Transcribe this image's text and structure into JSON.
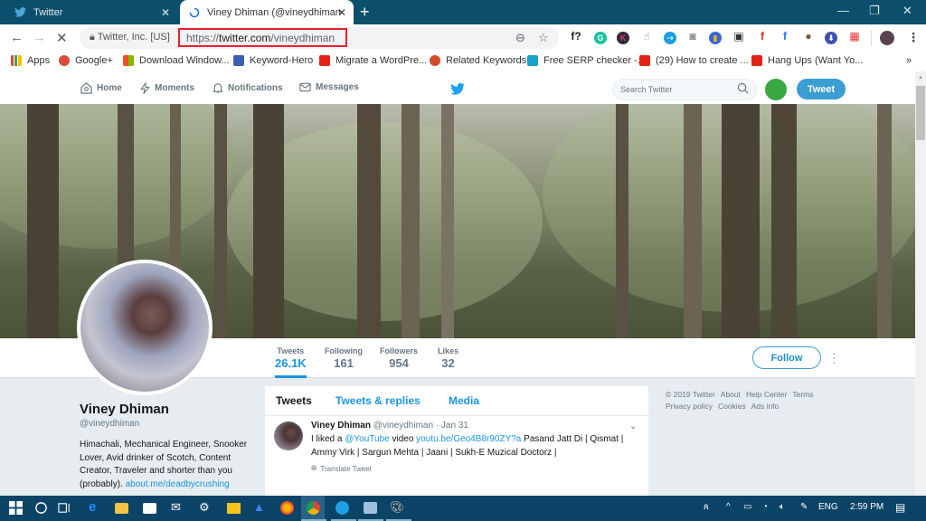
{
  "browser": {
    "tabs": [
      {
        "title": "Twitter",
        "active": false
      },
      {
        "title": "Viney Dhiman (@vineydhiman) | Twitter",
        "active": true
      }
    ],
    "new_tab_label": "+",
    "window_controls": {
      "minimize": "—",
      "maximize": "❐",
      "close": "✕"
    },
    "site_identity": "Twitter, Inc. [US]",
    "url_prefix": "https://",
    "url_domain": "twitter.com",
    "url_path": "/vineydhiman",
    "bookmarks": [
      {
        "label": "Apps",
        "icon": "apps-grid-icon",
        "color": "#e94235"
      },
      {
        "label": "Google+",
        "icon": "google-plus-icon",
        "color": "#dd4b39"
      },
      {
        "label": "Download Window...",
        "icon": "windows-icon",
        "color": "#00a4ef"
      },
      {
        "label": "Keyword-Hero",
        "icon": "keyword-hero-icon",
        "color": "#3b5fb0"
      },
      {
        "label": "Migrate a WordPre...",
        "icon": "youtube-icon",
        "color": "#e62117"
      },
      {
        "label": "Related Keywords",
        "icon": "circle-icon",
        "color": "#d44a2b"
      },
      {
        "label": "Free SERP checker -...",
        "icon": "serp-icon",
        "color": "#17a2c7"
      },
      {
        "label": "(29) How to create ...",
        "icon": "youtube-icon",
        "color": "#e62117"
      },
      {
        "label": "Hang Ups (Want Yo...",
        "icon": "youtube-icon",
        "color": "#e62117"
      }
    ],
    "bookmarks_overflow": "»",
    "extensions": [
      {
        "name": "formula-ext-icon",
        "glyph": "f?",
        "color": "#ffffff",
        "text": "#222"
      },
      {
        "name": "grammarly-icon",
        "glyph": "G",
        "color": "#15c39a",
        "text": "#fff"
      },
      {
        "name": "k-ext-icon",
        "glyph": "K",
        "color": "#2b2b3a",
        "text": "#e35"
      },
      {
        "name": "hand-ext-icon",
        "glyph": "☝",
        "color": "#ffffff",
        "text": "#888"
      },
      {
        "name": "share-ext-icon",
        "glyph": "⇢",
        "color": "#1a9fe0",
        "text": "#fff"
      },
      {
        "name": "camera-icon",
        "glyph": "◙",
        "color": "#ffffff",
        "text": "#888"
      },
      {
        "name": "lighthouse-icon",
        "glyph": "▮",
        "color": "#3367d6",
        "text": "#f4b400"
      },
      {
        "name": "pip-icon",
        "glyph": "▣",
        "color": "#ffffff",
        "text": "#333"
      },
      {
        "name": "facebook-red-icon",
        "glyph": "f",
        "color": "#ffffff",
        "text": "#d93025"
      },
      {
        "name": "facebook-blue-icon",
        "glyph": "f",
        "color": "#ffffff",
        "text": "#1a73e8"
      },
      {
        "name": "cookie-icon",
        "glyph": "●",
        "color": "#ffffff",
        "text": "#7a5a3a"
      },
      {
        "name": "download-ext-icon",
        "glyph": "⬇",
        "color": "#3f51b5",
        "text": "#fff"
      },
      {
        "name": "red-ext-icon",
        "glyph": "▦",
        "color": "#ffffff",
        "text": "#e33"
      }
    ]
  },
  "twitter": {
    "nav": [
      {
        "label": "Home",
        "icon": "home-icon"
      },
      {
        "label": "Moments",
        "icon": "moments-icon"
      },
      {
        "label": "Notifications",
        "icon": "notifications-icon"
      },
      {
        "label": "Messages",
        "icon": "messages-icon"
      }
    ],
    "search_placeholder": "Search Twitter",
    "tweet_button": "Tweet",
    "profile": {
      "name": "Viney Dhiman",
      "handle": "@vineydhiman",
      "bio": "Himachali, Mechanical Engineer, Snooker Lover, Avid drinker of Scotch, Content Creator, Traveler and shorter than you (probably).",
      "bio_link": "about.me/deadbycrushing"
    },
    "stats": [
      {
        "label": "Tweets",
        "value": "26.1K",
        "active": true
      },
      {
        "label": "Following",
        "value": "161",
        "active": false
      },
      {
        "label": "Followers",
        "value": "954",
        "active": false
      },
      {
        "label": "Likes",
        "value": "32",
        "active": false
      }
    ],
    "follow_button": "Follow",
    "timeline_tabs": [
      {
        "label": "Tweets",
        "active": true
      },
      {
        "label": "Tweets & replies",
        "active": false
      },
      {
        "label": "Media",
        "active": false
      }
    ],
    "tweet": {
      "name": "Viney Dhiman",
      "handle": "@vineydhiman",
      "time": "· Jan 31",
      "text_before_mention": "I liked a ",
      "mention": "@YouTube",
      "text_mid": " video ",
      "link": "youtu.be/Geo4B8r90ZY?a",
      "text_after": " Pasand Jatt Di | Qismat | Ammy Virk | Sargun Mehta | Jaani | Sukh-E Muzical Doctorz |",
      "translate": "Translate Tweet"
    },
    "footer_links": [
      "© 2019 Twitter",
      "About",
      "Help Center",
      "Terms",
      "Privacy policy",
      "Cookies",
      "Ads info"
    ]
  },
  "taskbar": {
    "tray_language": "ENG",
    "clock": "2:59 PM"
  },
  "colors": {
    "twitter_blue": "#1b95e0",
    "tab_strip": "#0b4f6c",
    "taskbar": "#0b4466",
    "url_highlight": "#e8212f"
  }
}
